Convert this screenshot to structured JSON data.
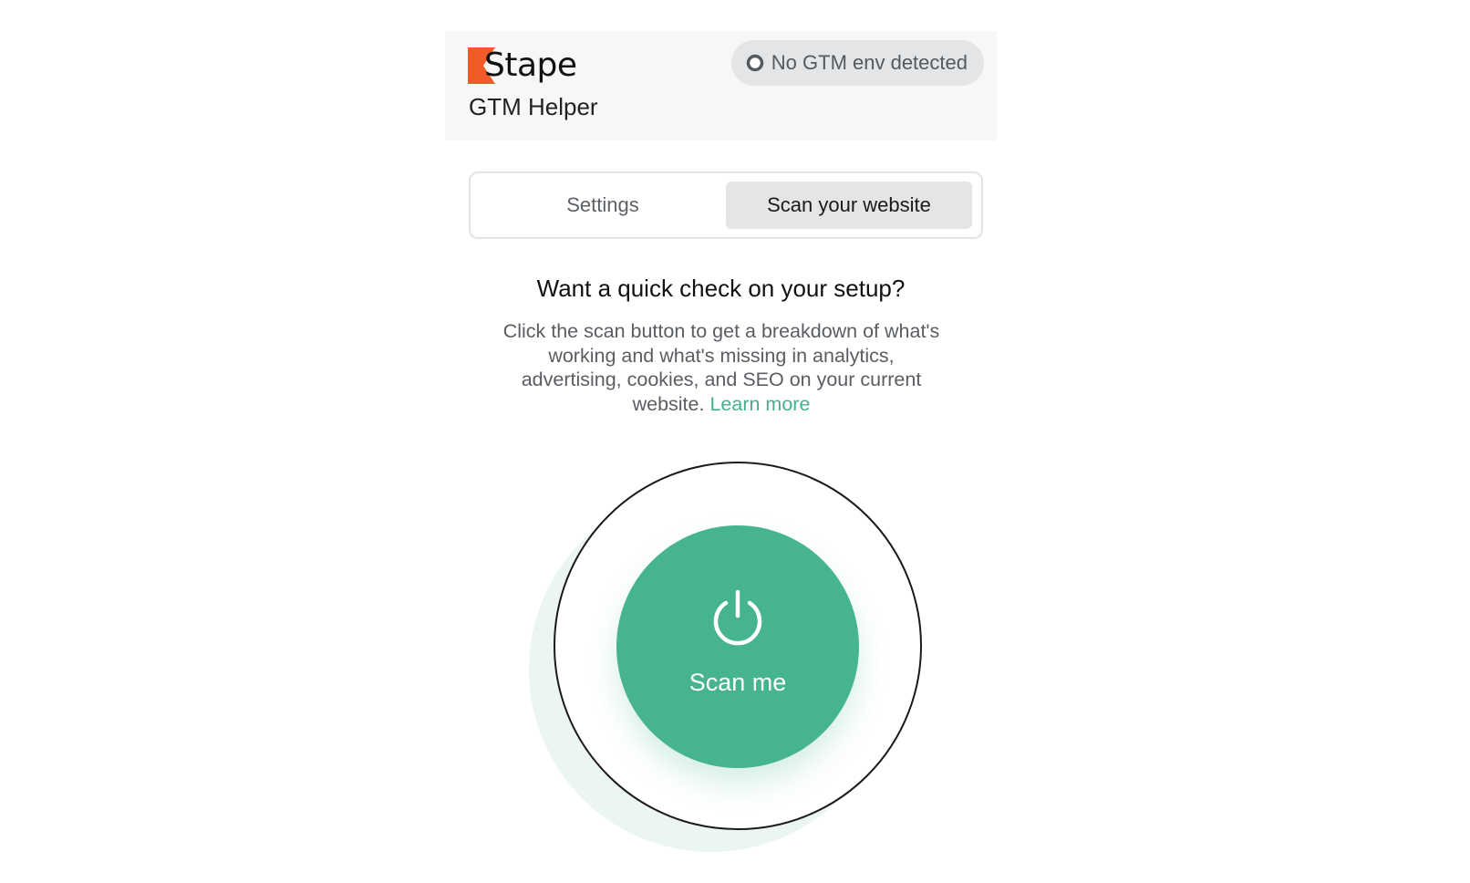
{
  "header": {
    "brand_name": "Stape",
    "subtitle": "GTM Helper",
    "status_text": "No GTM env detected"
  },
  "tabs": [
    {
      "label": "Settings",
      "active": false
    },
    {
      "label": "Scan your website",
      "active": true
    }
  ],
  "content": {
    "heading": "Want a quick check on your setup?",
    "description": "Click the scan button to get a breakdown of what's working and what's missing in analytics, advertising, cookies, and SEO on your current website.",
    "learn_more": "Learn more"
  },
  "scan_button": {
    "label": "Scan me",
    "icon": "power-icon"
  },
  "colors": {
    "brand_orange": "#f15a29",
    "accent_green": "#45b48f",
    "link_green": "#45b08c",
    "pill_bg": "#e4e5e6",
    "header_bg": "#f6f7f6"
  }
}
